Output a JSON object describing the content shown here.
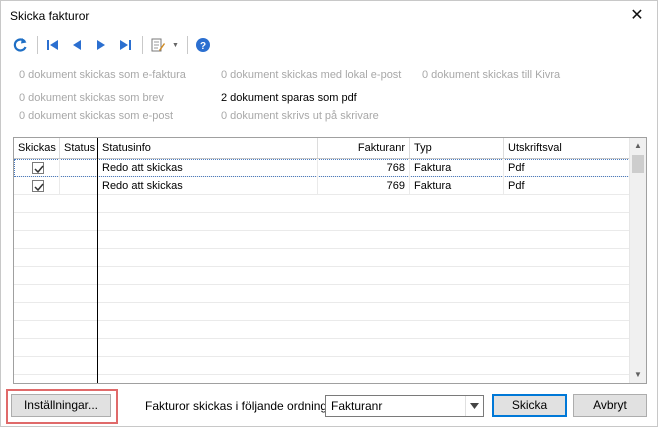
{
  "window": {
    "title": "Skicka fakturor"
  },
  "toolbar": {
    "buttons": [
      {
        "name": "refresh-icon"
      },
      {
        "name": "first-icon"
      },
      {
        "name": "prev-icon"
      },
      {
        "name": "next-icon"
      },
      {
        "name": "last-icon"
      },
      {
        "name": "tools-icon"
      },
      {
        "name": "help-icon"
      }
    ]
  },
  "summary": {
    "efaktura": "0 dokument skickas som e-faktura",
    "lokal_epost": "0 dokument skickas med lokal e-post",
    "kivra": "0 dokument skickas till Kivra",
    "brev": "0 dokument skickas som brev",
    "pdf": "2 dokument sparas som pdf",
    "epost": "0 dokument skickas som e-post",
    "skrivare": "0 dokument skrivs ut på skrivare"
  },
  "grid": {
    "headers": [
      "Skickas",
      "Status",
      "Statusinfo",
      "Fakturanr",
      "Typ",
      "Utskriftsval"
    ],
    "rows": [
      {
        "checked": true,
        "status": "",
        "statusinfo": "Redo att skickas",
        "fakturanr": "768",
        "typ": "Faktura",
        "utskriftsval": "Pdf"
      },
      {
        "checked": true,
        "status": "",
        "statusinfo": "Redo att skickas",
        "fakturanr": "769",
        "typ": "Faktura",
        "utskriftsval": "Pdf"
      }
    ]
  },
  "bottom": {
    "settings_label": "Inställningar...",
    "order_label": "Fakturor skickas i följande ordning:",
    "order_value": "Fakturanr",
    "send_label": "Skicka",
    "cancel_label": "Avbryt"
  },
  "colors": {
    "accent": "#0078d7",
    "highlight": "#e06a6a",
    "muted_text": "#a8a8a8"
  }
}
